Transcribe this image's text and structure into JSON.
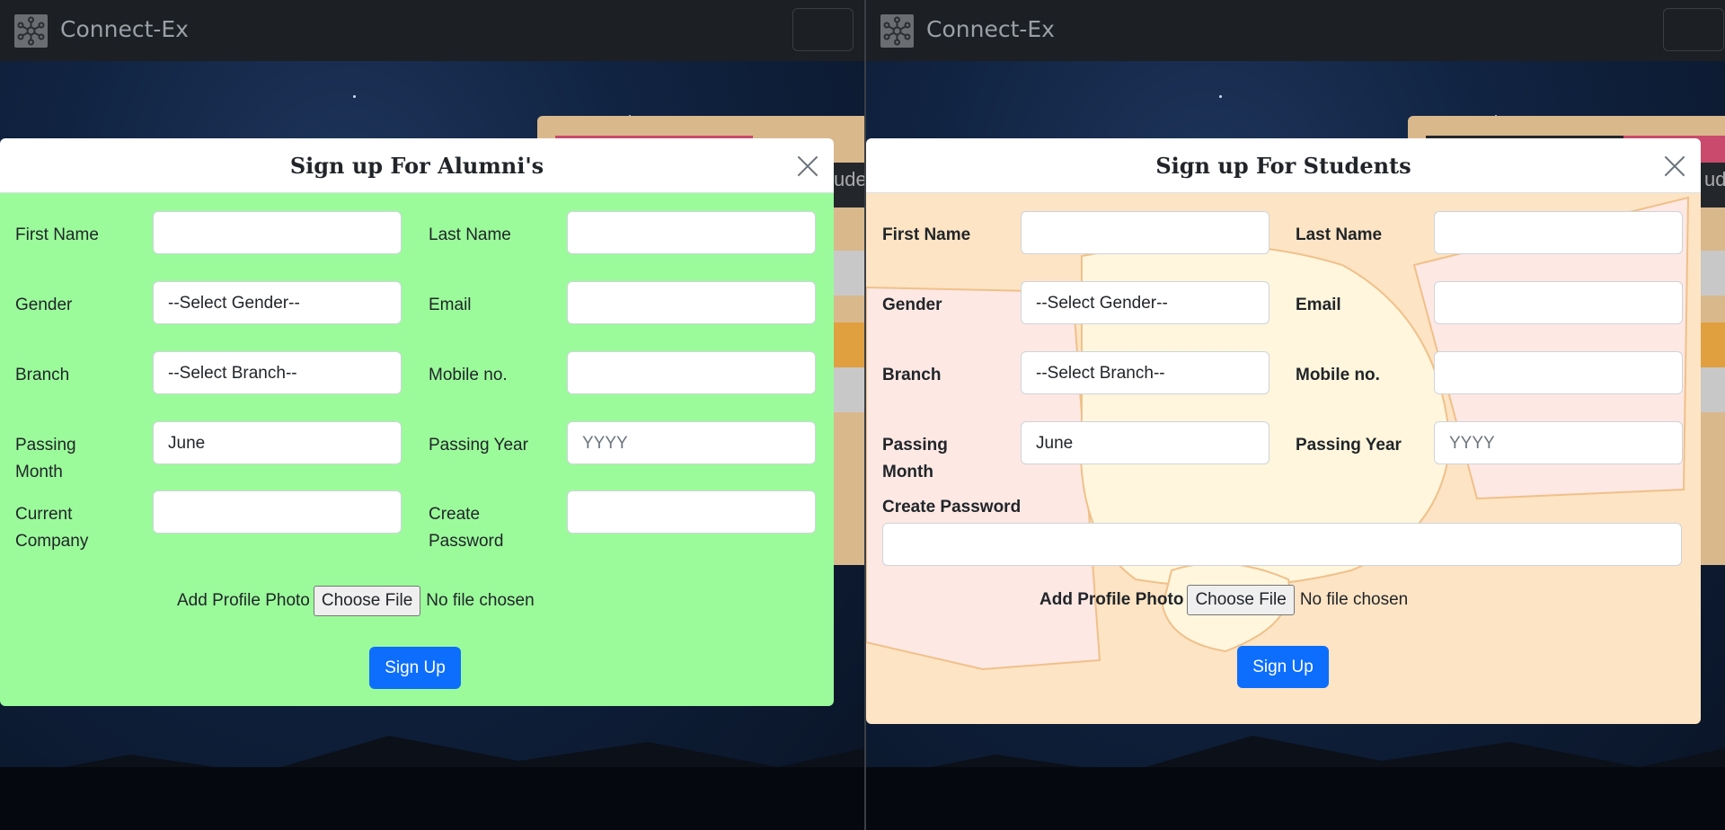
{
  "brand": "Connect-Ex",
  "bg_peek_text": "ude",
  "colors": {
    "alumni_body": "#9bfb9b",
    "students_body": "#fde4c4",
    "primary": "#0d6efd"
  },
  "alumni_modal": {
    "title": "Sign up For Alumni's",
    "labels": {
      "first_name": "First Name",
      "last_name": "Last Name",
      "gender": "Gender",
      "email": "Email",
      "branch": "Branch",
      "mobile": "Mobile no.",
      "passing_month_1": "Passing",
      "passing_month_2": "Month",
      "passing_year": "Passing Year",
      "current_company_1": "Current",
      "current_company_2": "Company",
      "create_password_1": "Create",
      "create_password_2": "Password",
      "add_photo": "Add Profile Photo"
    },
    "values": {
      "gender": "--Select Gender--",
      "branch": "--Select Branch--",
      "passing_month": "June",
      "passing_year_placeholder": "YYYY"
    },
    "file_button": "Choose File",
    "file_status": "No file chosen",
    "submit": "Sign Up"
  },
  "students_modal": {
    "title": "Sign up For Students",
    "labels": {
      "first_name": "First Name",
      "last_name": "Last Name",
      "gender": "Gender",
      "email": "Email",
      "branch": "Branch",
      "mobile": "Mobile no.",
      "passing_month_1": "Passing",
      "passing_month_2": "Month",
      "passing_year": "Passing Year",
      "create_password": "Create Password",
      "add_photo": "Add Profile Photo"
    },
    "values": {
      "gender": "--Select Gender--",
      "branch": "--Select Branch--",
      "passing_month": "June",
      "passing_year_placeholder": "YYYY"
    },
    "file_button": "Choose File",
    "file_status": "No file chosen",
    "submit": "Sign Up"
  }
}
